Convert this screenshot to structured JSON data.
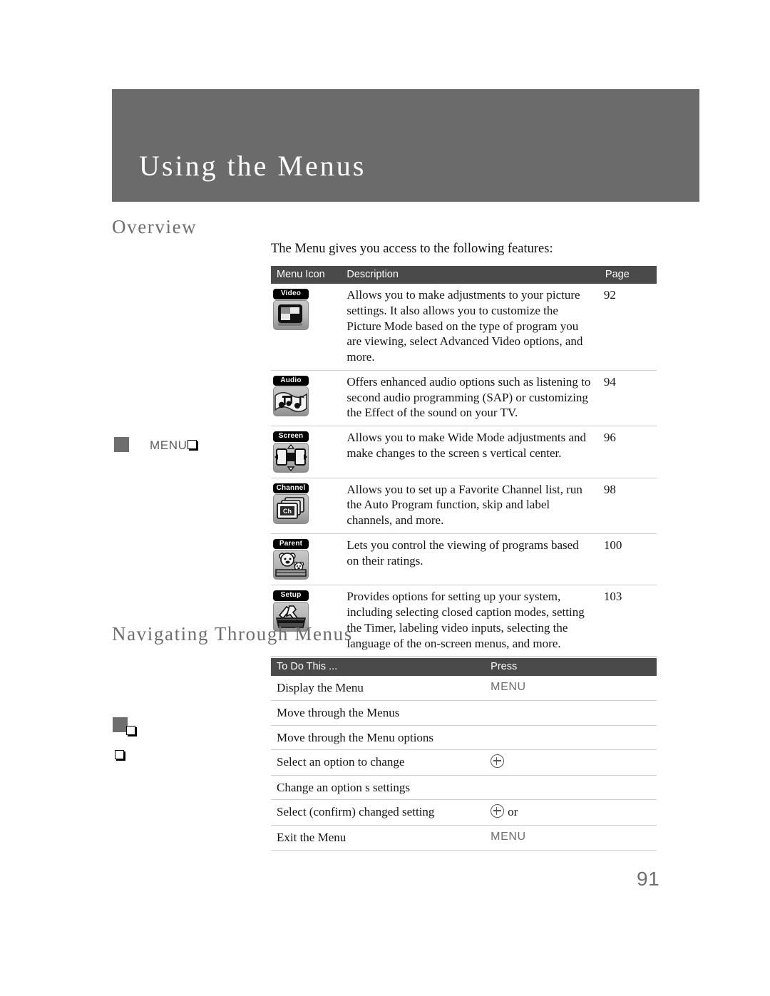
{
  "chapter": {
    "title": "Using the Menus"
  },
  "sections": {
    "overview": {
      "heading": "Overview",
      "intro": "The Menu gives you access to the following features:"
    },
    "navigating": {
      "heading": "Navigating Through Menus"
    }
  },
  "menu_icon_table": {
    "headers": {
      "icon": "Menu Icon",
      "description": "Description",
      "page": "Page"
    },
    "rows": [
      {
        "icon_label": "Video",
        "icon_name": "video-menu-icon",
        "description": "Allows you to make adjustments to your picture settings. It also allows you to customize the Picture Mode based on the type of program you are viewing, select Advanced Video options, and more.",
        "page": "92"
      },
      {
        "icon_label": "Audio",
        "icon_name": "audio-menu-icon",
        "description": "Offers enhanced audio options such as listening to second audio programming (SAP) or customizing the Effect of the sound on your TV.",
        "page": "94"
      },
      {
        "icon_label": "Screen",
        "icon_name": "screen-menu-icon",
        "description": "Allows you to make Wide Mode adjustments and make changes to the screen s vertical center.",
        "page": "96"
      },
      {
        "icon_label": "Channel",
        "icon_name": "channel-menu-icon",
        "description": "Allows you to set up a Favorite Channel list, run the Auto Program function, skip and label channels, and more.",
        "page": "98"
      },
      {
        "icon_label": "Parent",
        "icon_name": "parent-menu-icon",
        "description": "Lets you control the viewing of programs based on their ratings.",
        "page": "100"
      },
      {
        "icon_label": "Setup",
        "icon_name": "setup-menu-icon",
        "description": "Provides options for  setting up your system, including selecting closed caption modes, setting the Timer, labeling video inputs, selecting the language of the on-screen menus, and more.",
        "page": "103"
      }
    ]
  },
  "navigate_table": {
    "headers": {
      "todo": "To Do This ...",
      "press": "Press"
    },
    "rows": [
      {
        "todo": "Display the Menu",
        "press": "MENU",
        "press_kind": "text"
      },
      {
        "todo": "Move through the Menus",
        "press": "",
        "press_kind": "none"
      },
      {
        "todo": "Move through the Menu options",
        "press": "",
        "press_kind": "none"
      },
      {
        "todo": "Select an option to change",
        "press": "",
        "press_kind": "circle-plus"
      },
      {
        "todo": "Change an option s settings",
        "press": "",
        "press_kind": "none"
      },
      {
        "todo": "Select (confirm) changed setting",
        "press": "or",
        "press_kind": "circle-plus-or"
      },
      {
        "todo": "Exit the Menu",
        "press": "MENU",
        "press_kind": "text"
      }
    ]
  },
  "margin_notes": {
    "menu_label": "MENU"
  },
  "footer": {
    "page_number": "91"
  },
  "colors": {
    "banner": "#6b6b6b",
    "table_header": "#4a4a4a",
    "heading_gray": "#6e6e6e",
    "rule": "#cdcdcd"
  }
}
